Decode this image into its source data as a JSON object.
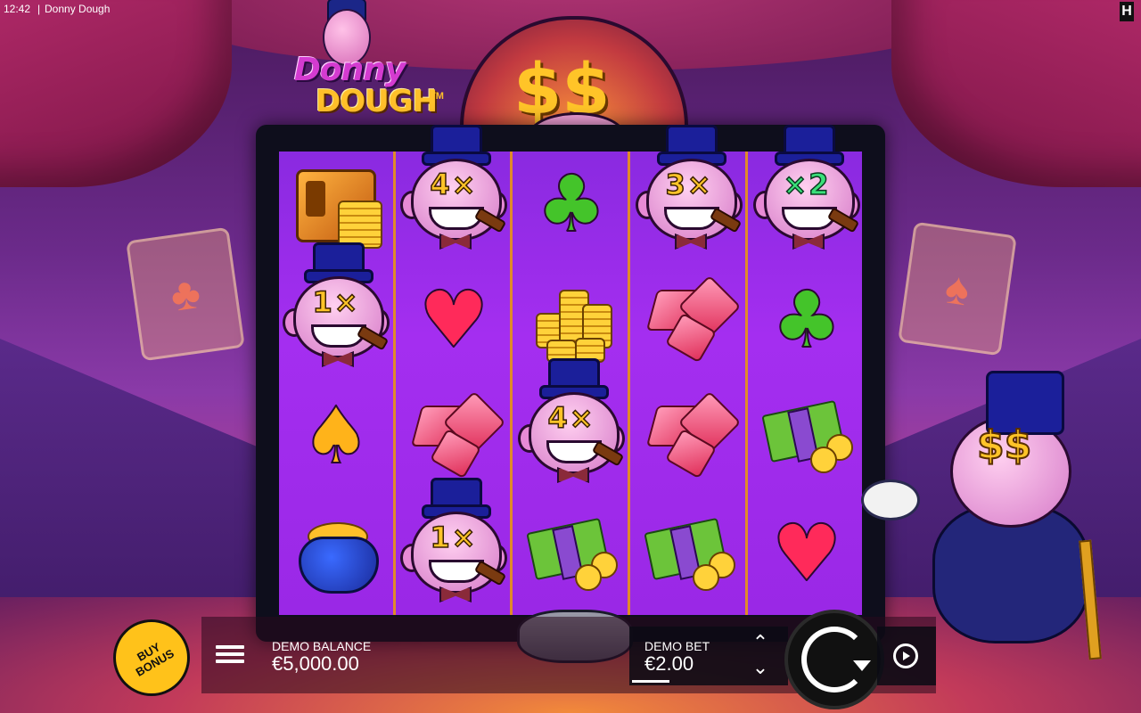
{
  "status": {
    "time": "12:42",
    "separator": "|",
    "window_title": "Donny Dough",
    "brand_mark": "H"
  },
  "logo": {
    "line1": "Donny",
    "line2": "DOUGH",
    "tm": "TM"
  },
  "arch": {
    "symbols": "$$"
  },
  "reels": [
    [
      "chest-coins",
      "donny-4x",
      "club",
      "donny-3x",
      "donny-x2"
    ],
    [
      "donny-1x",
      "heart",
      "coin-stack",
      "gems",
      "club"
    ],
    [
      "spade",
      "gems",
      "donny-4x",
      "gems",
      "cash-coins"
    ],
    [
      "coin-purse",
      "donny-1x",
      "cash-coins",
      "cash-coins",
      "heart"
    ]
  ],
  "multipliers": {
    "reel2_row1": "4×",
    "reel4_row1": "3×",
    "reel5_row1": "×2",
    "reel1_row2": "1×",
    "reel3_row3": "4×",
    "reel2_row4": "1×"
  },
  "mascot": {
    "eyes": "$$"
  },
  "hud": {
    "buy_bonus": "BUY\nBONUS",
    "balance_label": "DEMO BALANCE",
    "balance_value": "€5,000.00",
    "bet_label": "DEMO BET",
    "bet_value": "€2.00",
    "bet_up": "⌃",
    "bet_down": "⌄"
  }
}
